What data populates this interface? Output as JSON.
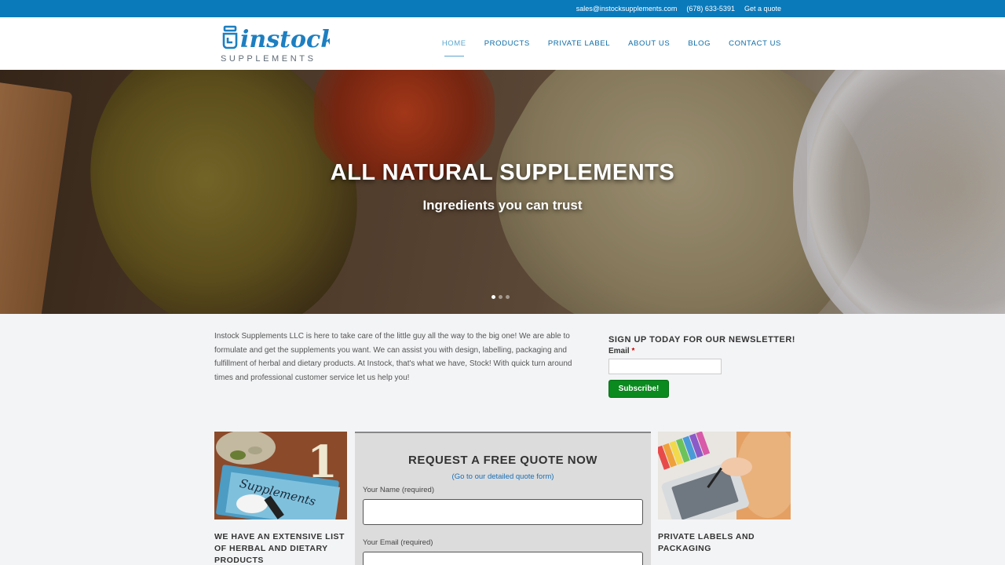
{
  "topbar": {
    "email": "sales@instocksupplements.com",
    "phone": "(678) 633-5391",
    "quote_link": "Get a quote"
  },
  "logo": {
    "main": "instock",
    "sub": "SUPPLEMENTS"
  },
  "nav": {
    "items": [
      {
        "label": "HOME",
        "active": true
      },
      {
        "label": "PRODUCTS"
      },
      {
        "label": "PRIVATE LABEL"
      },
      {
        "label": "ABOUT US"
      },
      {
        "label": "BLOG"
      },
      {
        "label": "CONTACT US"
      }
    ]
  },
  "hero": {
    "title": "ALL NATURAL SUPPLEMENTS",
    "subtitle": "Ingredients you can trust",
    "slide_count": 3,
    "active_slide": 1
  },
  "intro": {
    "text": "Instock Supplements LLC is here to take care of the little guy all the way to the big one! We are able to formulate and get the supplements you want. We can assist you with design, labelling, packaging and fulfillment of herbal and dietary products. At Instock, that's what we have, Stock! With quick turn around times and professional customer service let us help you!"
  },
  "newsletter": {
    "title": "SIGN UP TODAY FOR OUR NEWSLETTER!",
    "email_label": "Email",
    "required_mark": "*",
    "button": "Subscribe!"
  },
  "cards": {
    "left": {
      "title": "WE HAVE AN EXTENSIVE LIST OF HERBAL AND DIETARY PRODUCTS",
      "image_text": "Supplements",
      "image_number": "1"
    },
    "right": {
      "title": "PRIVATE LABELS AND PACKAGING"
    }
  },
  "quote": {
    "title": "REQUEST A FREE QUOTE NOW",
    "link": "(Go to our detailed quote form)",
    "name_label": "Your Name (required)",
    "email_label": "Your Email (required)"
  },
  "colors": {
    "brand_blue": "#0a7abb",
    "subscribe_green": "#0a8a1f"
  }
}
